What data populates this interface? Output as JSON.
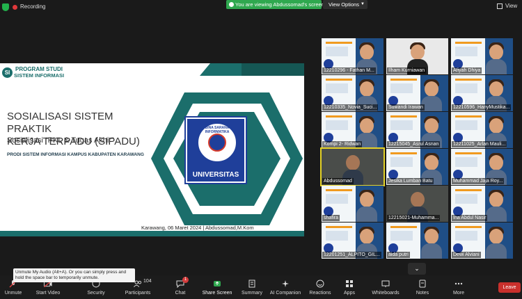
{
  "topbar": {
    "recording": "Recording",
    "viewing_banner": "You are viewing Abdussomad's screen",
    "view_options": "View Options",
    "view_right": "View"
  },
  "slide": {
    "logo_line1": "PROGRAM STUDI",
    "logo_line2": "SISTEM INFORMASI",
    "logo_mark": "SI",
    "title_line1": "SOSIALISASI SISTEM PRAKTIK",
    "title_line2": "KERJA TERPADU (SIPADU)",
    "subtitle": "Sosialisasi  “PKL & Tugas Akhir”",
    "prodi": "PRODI SISTEM INFORMASI KAMPUS KABUPATEN KARAWANG",
    "footer": "Karawang, 06 Maret 2024 | Abdussomad,M.Kom",
    "badge_ring": "BINA SARANA INFORMATIKA",
    "badge_mark": "BSI",
    "badge_label": "UNIVERSITAS"
  },
  "participants": [
    {
      "name": "12210296 - Fathan M...",
      "kind": "slide"
    },
    {
      "name": "Ilham Kurniawan",
      "kind": "avatar"
    },
    {
      "name": "Afiyah Dhiya",
      "kind": "slide"
    },
    {
      "name": "12210335_Novia_Suci...",
      "kind": "slide"
    },
    {
      "name": "Suwandi Irawan",
      "kind": "slide"
    },
    {
      "name": "12210596_HanyMustika...",
      "kind": "slide"
    },
    {
      "name": "Kompi 2- Ridwan",
      "kind": "slide"
    },
    {
      "name": "12215045_Asrul Asnan",
      "kind": "slide"
    },
    {
      "name": "12211025_Arlan Mauli...",
      "kind": "slide"
    },
    {
      "name": "Abdussomad",
      "kind": "camera"
    },
    {
      "name": "Jesika Lumban Batu",
      "kind": "slide"
    },
    {
      "name": "Muhammad Jaja Roy...",
      "kind": "slide"
    },
    {
      "name": "shafira",
      "kind": "slide"
    },
    {
      "name": "12215021-Muhamma...",
      "kind": "camera"
    },
    {
      "name": "Ina Abdul Nasir",
      "kind": "slide"
    },
    {
      "name": "12201251_ALPITO_GIL...",
      "kind": "slide"
    },
    {
      "name": "aida putri",
      "kind": "slide"
    },
    {
      "name": "Dewi Alviani",
      "kind": "slide"
    }
  ],
  "tooltip": "Unmute My Audio (Alt+A). Or you can simply press and hold the space bar to temporarily unmute.",
  "toolbar": {
    "unmute": "Unmute",
    "start_video": "Start Video",
    "security": "Security",
    "participants": "Participants",
    "participants_count": "104",
    "chat": "Chat",
    "chat_badge": "1",
    "share_screen": "Share Screen",
    "summary": "Summary",
    "ai_companion": "AI Companion",
    "reactions": "Reactions",
    "apps": "Apps",
    "whiteboards": "Whiteboards",
    "notes": "Notes",
    "more": "More",
    "leave": "Leave"
  },
  "colors": {
    "accent_teal": "#1b6e6b",
    "share_green": "#2fa84f",
    "leave_red": "#c9302c",
    "active_speaker": "#e5d226"
  }
}
